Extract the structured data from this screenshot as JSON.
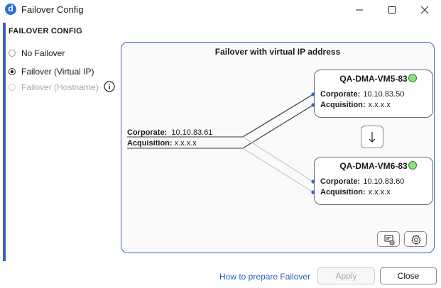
{
  "window": {
    "title": "Failover Config"
  },
  "section": {
    "title": "FAILOVER CONFIG"
  },
  "options": [
    {
      "label": "No Failover",
      "checked": false,
      "disabled": false
    },
    {
      "label": "Failover (Virtual IP)",
      "checked": true,
      "disabled": false
    },
    {
      "label": "Failover (Hostname)",
      "checked": false,
      "disabled": true
    }
  ],
  "panel": {
    "title": "Failover with virtual IP address"
  },
  "source": {
    "corporate_label": "Corporate:",
    "corporate_value": "10.10.83.61",
    "acquisition_label": "Acquisition:",
    "acquisition_value": "x.x.x.x"
  },
  "nodes": [
    {
      "name": "QA-DMA-VM5-83",
      "status": "online",
      "corporate_label": "Corporate:",
      "corporate_value": "10.10.83.50",
      "acquisition_label": "Acquisition:",
      "acquisition_value": "x.x.x.x"
    },
    {
      "name": "QA-DMA-VM6-83",
      "status": "online",
      "corporate_label": "Corporate:",
      "corporate_value": "10.10.83.60",
      "acquisition_label": "Acquisition:",
      "acquisition_value": "x.x.x.x"
    }
  ],
  "footer": {
    "help_link": "How to prepare Failover",
    "apply_label": "Apply",
    "close_label": "Close"
  },
  "colors": {
    "accent": "#3a5fcd",
    "status_online": "#8ee07f",
    "link": "#2b5fbf"
  }
}
